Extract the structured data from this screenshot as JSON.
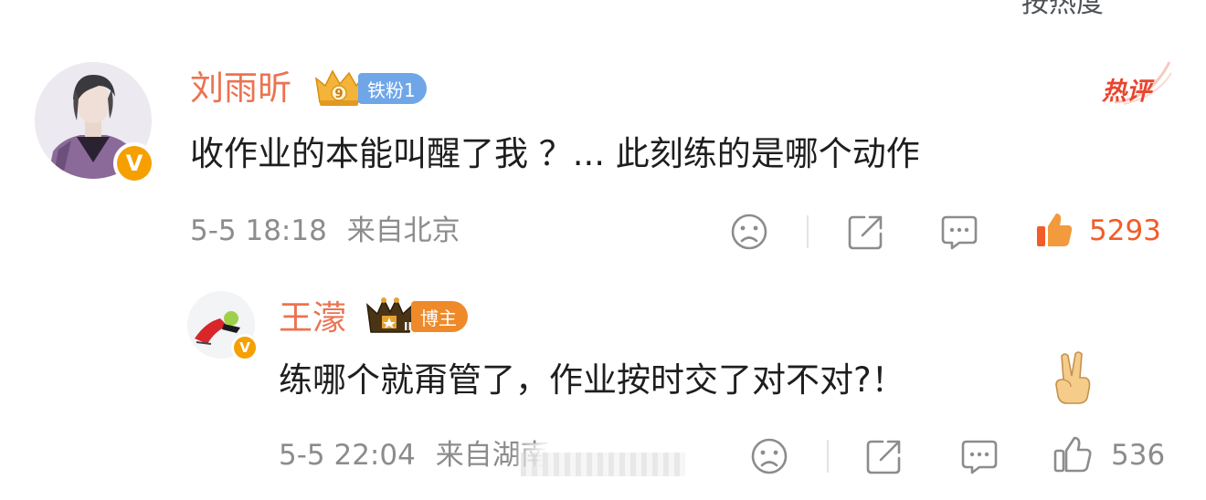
{
  "top": {
    "sort_label": "按热度"
  },
  "comment": {
    "username": "刘雨昕",
    "fan_badge": {
      "level_text": "铁粉1",
      "level_number": "9"
    },
    "hot_tag": "热评",
    "text": "收作业的本能叫醒了我 ？... 此刻练的是哪个动作",
    "time": "5-5 18:18",
    "location": "来自北京",
    "like_count": "5293",
    "verified_badge": "V",
    "colors": {
      "username": "#eb7350",
      "like_active": "#f25c28",
      "fan_pill": "#6fa6e8"
    }
  },
  "reply": {
    "username": "王濛",
    "role_badge": "博主",
    "text": "练哪个就甭管了，作业按时交了对不对?！",
    "emoji": "victory-hand",
    "time": "5-5 22:04",
    "location": "来自湖南",
    "like_count": "536",
    "verified_badge": "V",
    "colors": {
      "role_pill": "#ee8a2a"
    }
  },
  "icons": {
    "dislike": "sad-face-icon",
    "share": "share-icon",
    "comment": "comment-bubble-icon",
    "like": "thumbs-up-icon"
  }
}
